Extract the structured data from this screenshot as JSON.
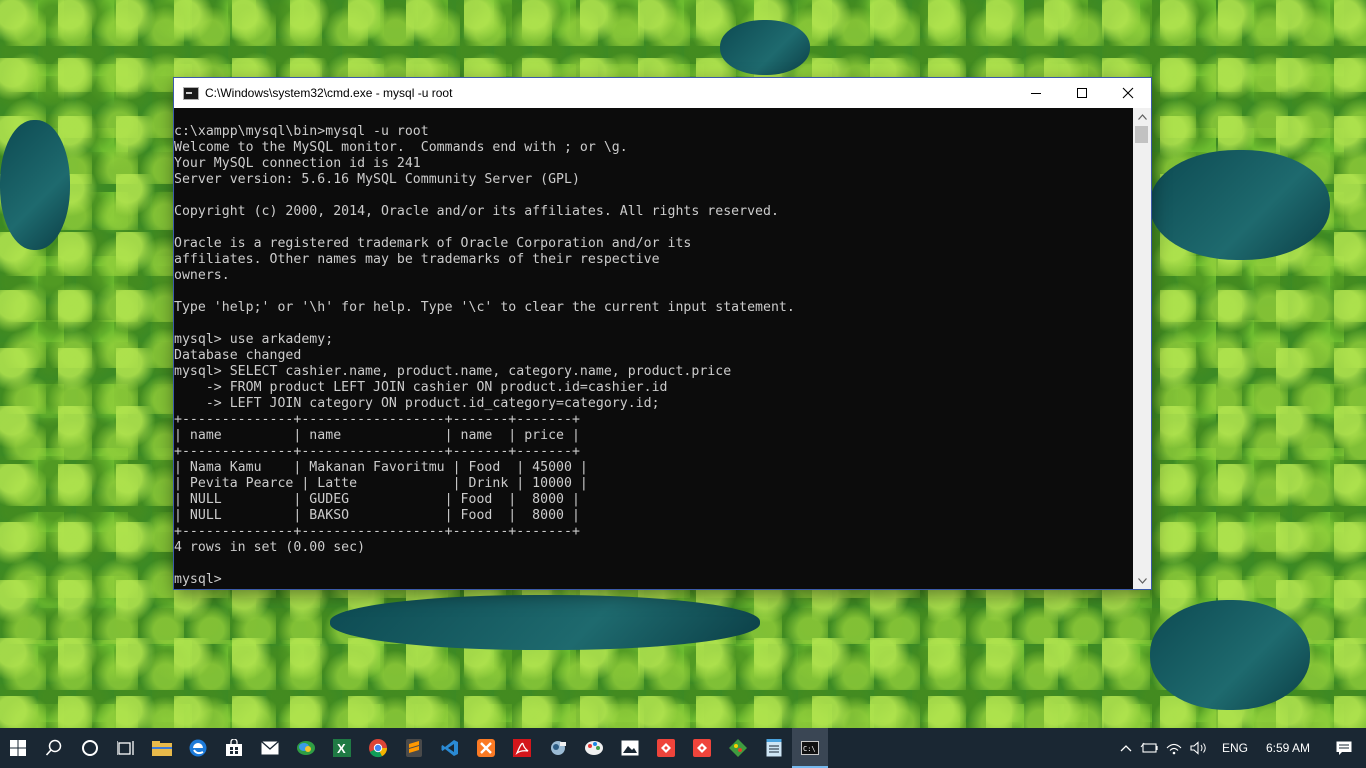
{
  "window": {
    "title": "C:\\Windows\\system32\\cmd.exe - mysql  -u root",
    "terminal_lines": [
      "c:\\xampp\\mysql\\bin>mysql -u root",
      "Welcome to the MySQL monitor.  Commands end with ; or \\g.",
      "Your MySQL connection id is 241",
      "Server version: 5.6.16 MySQL Community Server (GPL)",
      "",
      "Copyright (c) 2000, 2014, Oracle and/or its affiliates. All rights reserved.",
      "",
      "Oracle is a registered trademark of Oracle Corporation and/or its",
      "affiliates. Other names may be trademarks of their respective",
      "owners.",
      "",
      "Type 'help;' or '\\h' for help. Type '\\c' to clear the current input statement.",
      "",
      "mysql> use arkademy;",
      "Database changed",
      "mysql> SELECT cashier.name, product.name, category.name, product.price",
      "    -> FROM product LEFT JOIN cashier ON product.id=cashier.id",
      "    -> LEFT JOIN category ON product.id_category=category.id;",
      "+--------------+------------------+-------+-------+",
      "| name         | name             | name  | price |",
      "+--------------+------------------+-------+-------+",
      "| Nama Kamu    | Makanan Favoritmu | Food  | 45000 |",
      "| Pevita Pearce | Latte            | Drink | 10000 |",
      "| NULL         | GUDEG            | Food  |  8000 |",
      "| NULL         | BAKSO            | Food  |  8000 |",
      "+--------------+------------------+-------+-------+",
      "4 rows in set (0.00 sec)",
      "",
      "mysql> "
    ]
  },
  "taskbar": {
    "apps": [
      "start-icon",
      "search-icon",
      "cortana-icon",
      "task-view-icon",
      "file-explorer-icon",
      "edge-icon",
      "store-icon",
      "mail-icon",
      "photos-icon",
      "excel-icon",
      "chrome-icon",
      "sublime-icon",
      "vscode-icon",
      "xampp-icon",
      "acrobat-icon",
      "app-icon",
      "paint-icon",
      "gallery-icon",
      "anydesk-icon",
      "anydesk2-icon",
      "git-icon",
      "notepad-icon",
      "cmd-icon"
    ],
    "language": "ENG",
    "time": "6:59 AM"
  },
  "colors": {
    "terminal_bg": "#0c0c0c",
    "terminal_text": "#cccccc",
    "taskbar_bg": "#1a2733",
    "accent": "#76b9ed"
  }
}
